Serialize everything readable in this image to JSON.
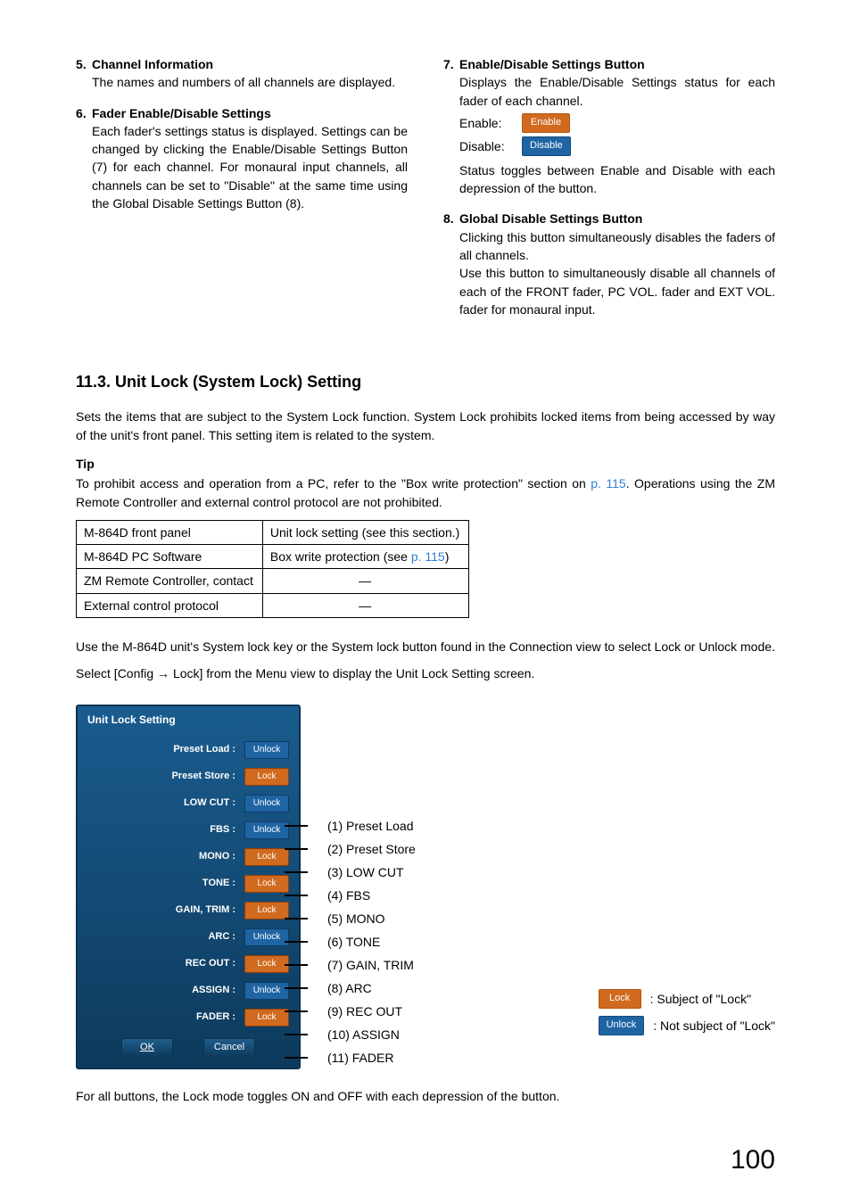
{
  "top_left": {
    "item5": {
      "num": "5.",
      "title": "Channel Information",
      "body": "The names and numbers of all channels are displayed."
    },
    "item6": {
      "num": "6.",
      "title": "Fader Enable/Disable Settings",
      "body": "Each fader's settings status is displayed. Settings can be changed by clicking the Enable/Disable Settings Button (7) for each channel. For monaural input channels, all channels can be set to \"Disable\" at the same time using the Global Disable Settings Button (8)."
    }
  },
  "top_right": {
    "item7": {
      "num": "7.",
      "title": "Enable/Disable Settings Button",
      "body1": "Displays the Enable/Disable Settings status for each fader of each channel.",
      "enable_label": "Enable:",
      "enable_chip": "Enable",
      "disable_label": "Disable:",
      "disable_chip": "Disable",
      "body2": "Status toggles between Enable and Disable with each depression of the button."
    },
    "item8": {
      "num": "8.",
      "title": "Global Disable Settings Button",
      "body1": "Clicking this button simultaneously disables the faders of all channels.",
      "body2": "Use this button to simultaneously disable all channels of each of the FRONT fader, PC VOL. fader and EXT VOL. fader for monaural input."
    }
  },
  "section": {
    "heading": "11.3. Unit Lock (System Lock) Setting",
    "intro": "Sets the items that are subject to the System Lock function. System Lock prohibits locked items from being accessed by way of the unit's front panel. This setting item is related to the system.",
    "tip_head": "Tip",
    "tip_body_a": "To prohibit access and operation from a PC, refer to the \"Box write protection\" section on ",
    "tip_link": "p. 115",
    "tip_body_b": ". Operations using the ZM Remote Controller and external control protocol are not prohibited.",
    "table": {
      "r1c1": "M-864D front panel",
      "r1c2": "Unit lock setting (see this section.)",
      "r2c1": "M-864D PC Software",
      "r2c2a": "Box write protection (see ",
      "r2c2_link": "p. 115",
      "r2c2b": ")",
      "r3c1": "ZM Remote Controller, contact",
      "r3c2": "—",
      "r4c1": "External control protocol",
      "r4c2": "—"
    },
    "para2": "Use the M-864D unit's System lock key or the System lock button found in the Connection view to select Lock or Unlock mode.",
    "para3": "Select [Config → Lock] from the Menu view to display the Unit Lock Setting screen.",
    "panel_title": "Unit Lock Setting",
    "panel_rows": [
      {
        "label": "Preset Load :",
        "state": "Unlock",
        "kind": "unlock",
        "callout": "(1) Preset Load"
      },
      {
        "label": "Preset Store :",
        "state": "Lock",
        "kind": "lock",
        "callout": "(2) Preset Store"
      },
      {
        "label": "LOW CUT :",
        "state": "Unlock",
        "kind": "unlock",
        "callout": "(3) LOW CUT"
      },
      {
        "label": "FBS :",
        "state": "Unlock",
        "kind": "unlock",
        "callout": "(4) FBS"
      },
      {
        "label": "MONO :",
        "state": "Lock",
        "kind": "lock",
        "callout": "(5) MONO"
      },
      {
        "label": "TONE :",
        "state": "Lock",
        "kind": "lock",
        "callout": "(6) TONE"
      },
      {
        "label": "GAIN, TRIM :",
        "state": "Lock",
        "kind": "lock",
        "callout": "(7) GAIN, TRIM"
      },
      {
        "label": "ARC :",
        "state": "Unlock",
        "kind": "unlock",
        "callout": "(8) ARC"
      },
      {
        "label": "REC OUT :",
        "state": "Lock",
        "kind": "lock",
        "callout": "(9) REC OUT"
      },
      {
        "label": "ASSIGN :",
        "state": "Unlock",
        "kind": "unlock",
        "callout": "(10) ASSIGN"
      },
      {
        "label": "FADER :",
        "state": "Lock",
        "kind": "lock",
        "callout": "(11) FADER"
      }
    ],
    "panel_foot": {
      "ok": "OK",
      "cancel": "Cancel"
    },
    "legend": {
      "lock_chip": "Lock",
      "lock_text": ": Subject of \"Lock\"",
      "unlock_chip": "Unlock",
      "unlock_text": ": Not subject of \"Lock\""
    },
    "closing": "For all buttons, the Lock mode toggles ON and OFF with each depression of the button."
  },
  "page_number": "100"
}
